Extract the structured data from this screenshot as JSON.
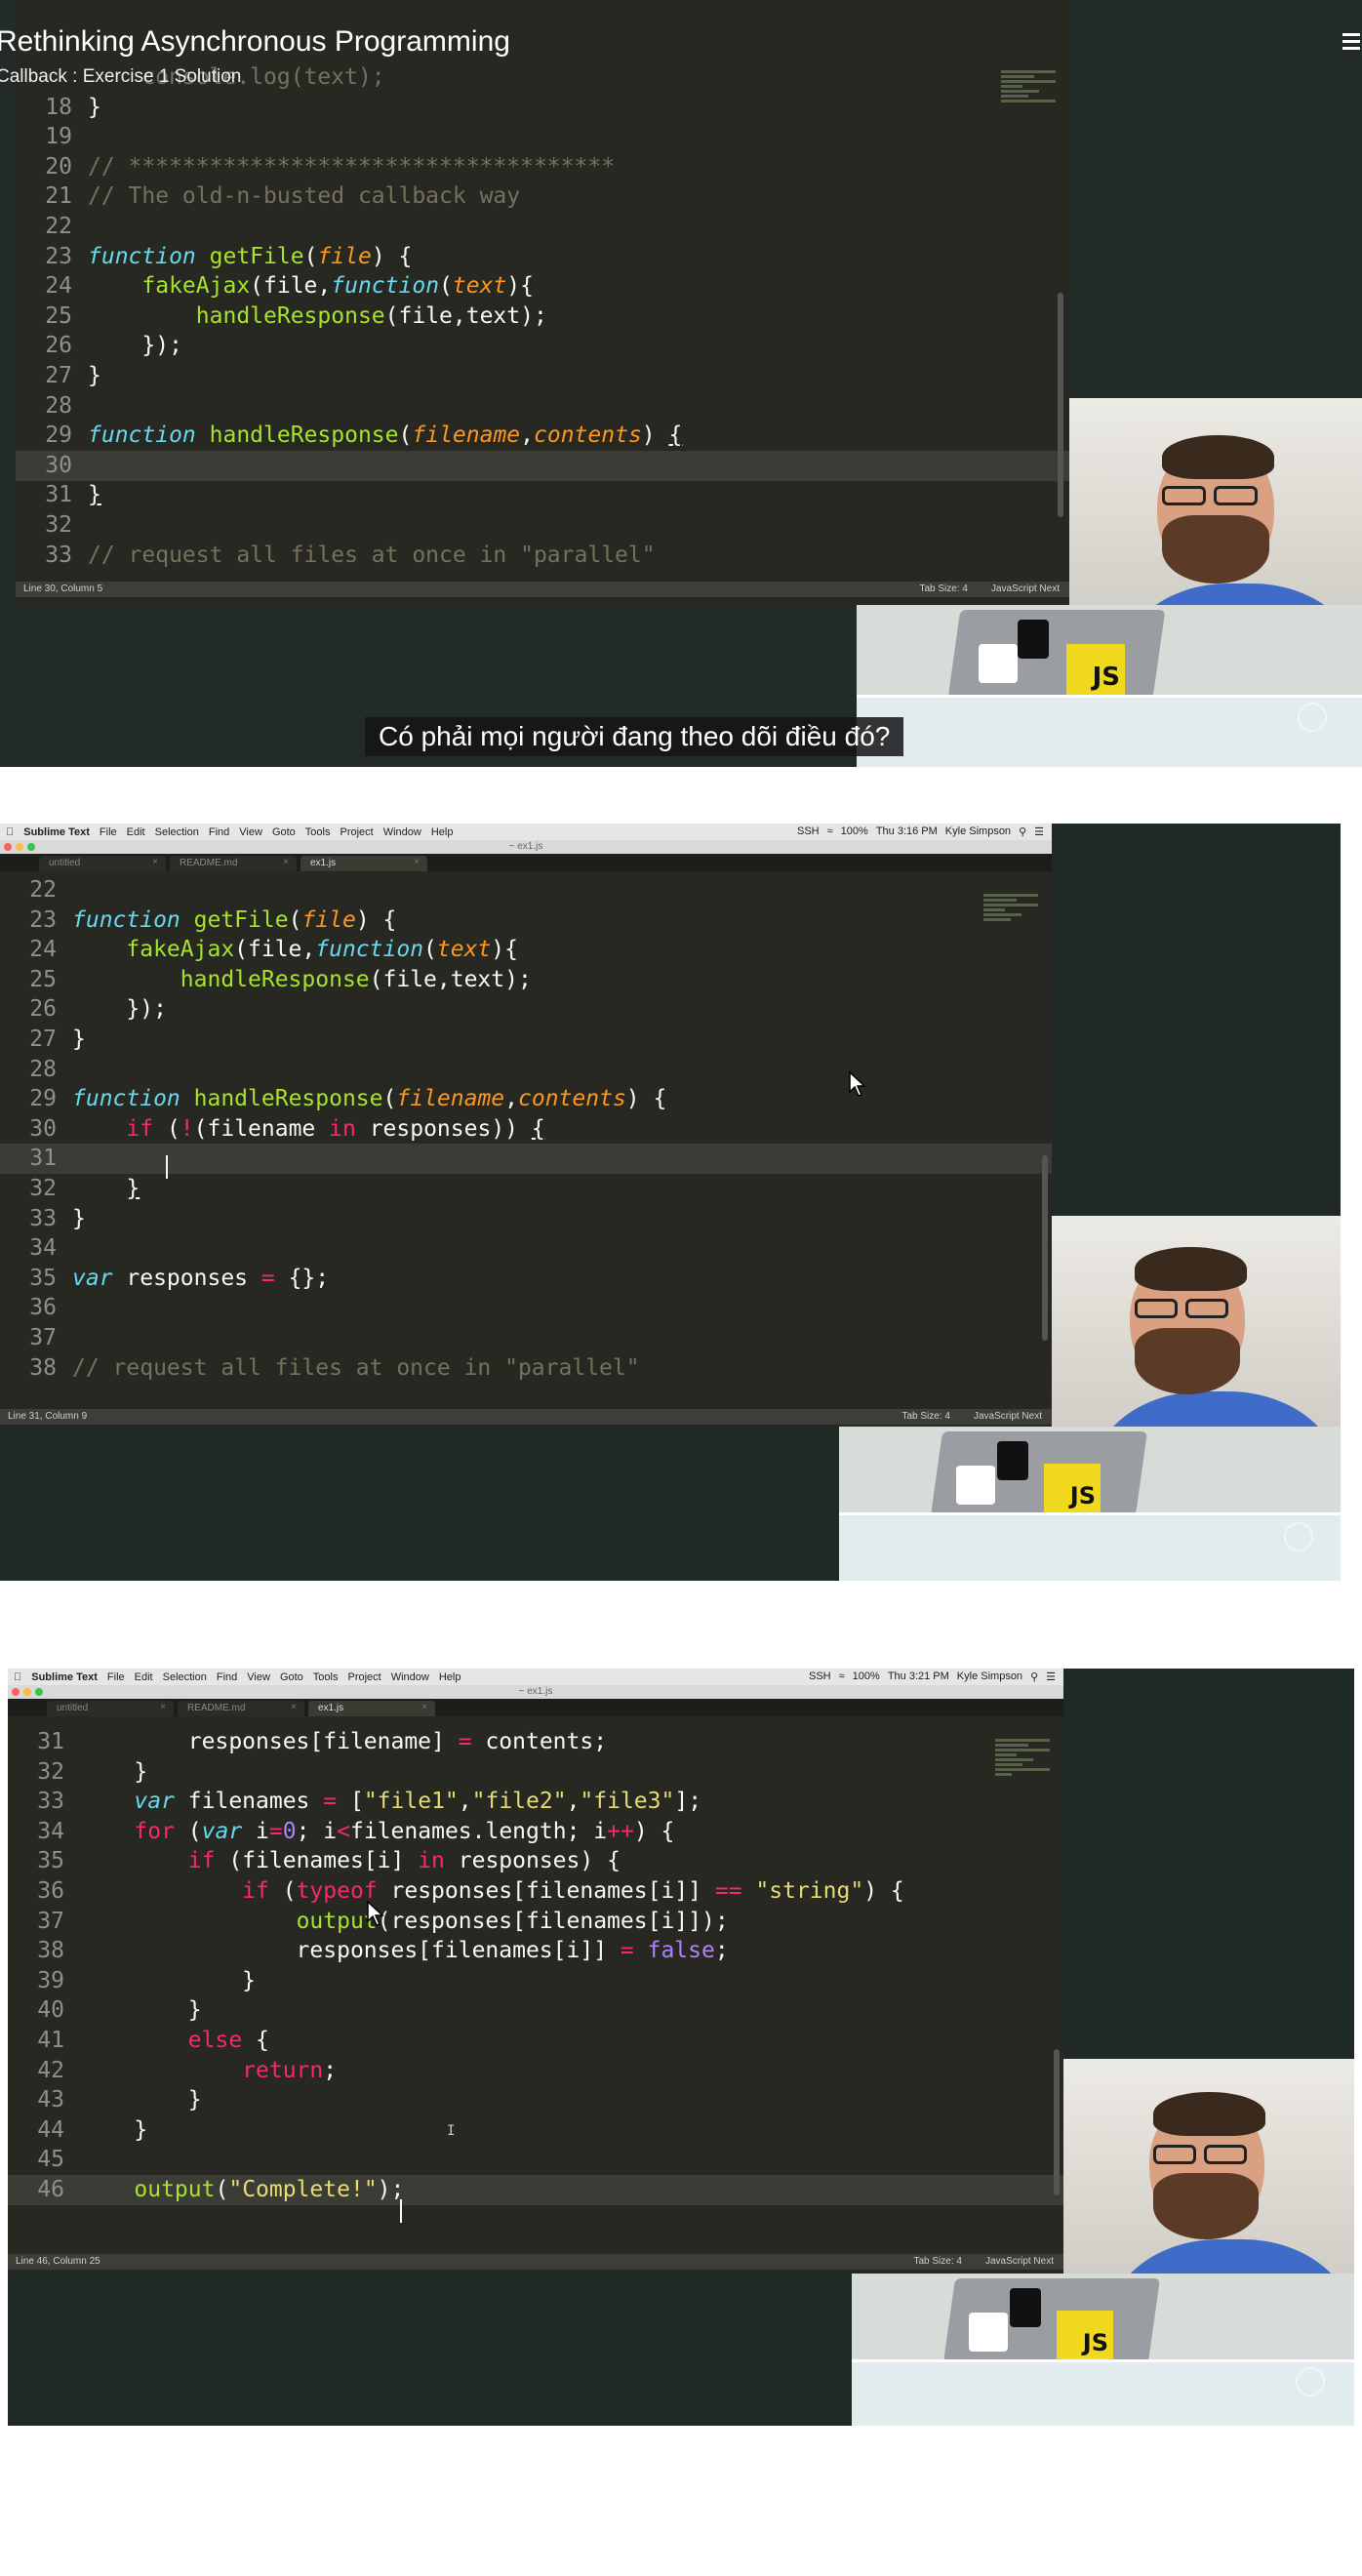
{
  "video": {
    "title": "Rethinking Asynchronous Programming",
    "subtitle": "Callback : Exercise 1 Solution",
    "caption": "Có phải mọi người đang theo dõi điều đó?"
  },
  "panel1": {
    "status": "Line 30, Column 5",
    "tab_size": "Tab Size: 4",
    "syntax": "JavaScript Next",
    "lines": [
      {
        "n": "",
        "html": "<span class='c'>    console.log(text);</span>"
      },
      {
        "n": "18",
        "html": "}"
      },
      {
        "n": "19",
        "html": ""
      },
      {
        "n": "20",
        "html": "<span class='c'>// ************************************</span>"
      },
      {
        "n": "21",
        "html": "<span class='c'>// The old-n-busted callback way</span>"
      },
      {
        "n": "22",
        "html": ""
      },
      {
        "n": "23",
        "html": "<span class='k'>function</span> <span class='fn'>getFile</span>(<span class='p'>file</span>) {"
      },
      {
        "n": "24",
        "html": "    <span class='fn'>fakeAjax</span>(file,<span class='k'>function</span>(<span class='p'>text</span>){"
      },
      {
        "n": "25",
        "html": "        <span class='fn'>handleResponse</span>(file,text);"
      },
      {
        "n": "26",
        "html": "    });"
      },
      {
        "n": "27",
        "html": "}"
      },
      {
        "n": "28",
        "html": ""
      },
      {
        "n": "29",
        "html": "<span class='k'>function</span> <span class='fn'>handleResponse</span>(<span class='p'>filename</span>,<span class='p'>contents</span>) <u>{</u>"
      },
      {
        "n": "30",
        "html": "",
        "hl": true
      },
      {
        "n": "31",
        "html": "<u>}</u>"
      },
      {
        "n": "32",
        "html": ""
      },
      {
        "n": "33",
        "html": "<span class='c'>// request all files at once in \"parallel\"</span>"
      }
    ]
  },
  "panel2": {
    "menubar": {
      "app": "Sublime Text",
      "items": [
        "File",
        "Edit",
        "Selection",
        "Find",
        "View",
        "Goto",
        "Tools",
        "Project",
        "Window",
        "Help"
      ],
      "right": [
        "SSH",
        "100%",
        "Thu 3:16 PM",
        "Kyle Simpson"
      ]
    },
    "window_title": "~ ex1.js",
    "tabs": [
      "untitled",
      "README.md",
      "ex1.js"
    ],
    "status": "Line 31, Column 9",
    "tab_size": "Tab Size: 4",
    "syntax": "JavaScript Next",
    "lines": [
      {
        "n": "22",
        "html": ""
      },
      {
        "n": "23",
        "html": "<span class='k'>function</span> <span class='fn'>getFile</span>(<span class='p'>file</span>) {"
      },
      {
        "n": "24",
        "html": "    <span class='fn'>fakeAjax</span>(file,<span class='k'>function</span>(<span class='p'>text</span>){"
      },
      {
        "n": "25",
        "html": "        <span class='fn'>handleResponse</span>(file,text);"
      },
      {
        "n": "26",
        "html": "    });"
      },
      {
        "n": "27",
        "html": "}"
      },
      {
        "n": "28",
        "html": ""
      },
      {
        "n": "29",
        "html": "<span class='k'>function</span> <span class='fn'>handleResponse</span>(<span class='p'>filename</span>,<span class='p'>contents</span>) {"
      },
      {
        "n": "30",
        "html": "    <span class='kw'>if</span> (<span class='kw'>!</span>(filename <span class='kw'>in</span> responses)) <u>{</u>"
      },
      {
        "n": "31",
        "html": "        ",
        "hl": true
      },
      {
        "n": "32",
        "html": "    <u>}</u>"
      },
      {
        "n": "33",
        "html": "}"
      },
      {
        "n": "34",
        "html": ""
      },
      {
        "n": "35",
        "html": "<span class='k'>var</span> responses <span class='kw'>=</span> {};"
      },
      {
        "n": "36",
        "html": ""
      },
      {
        "n": "37",
        "html": ""
      },
      {
        "n": "38",
        "html": "<span class='c'>// request all files at once in \"parallel\"</span>"
      }
    ]
  },
  "panel3": {
    "menubar": {
      "app": "Sublime Text",
      "items": [
        "File",
        "Edit",
        "Selection",
        "Find",
        "View",
        "Goto",
        "Tools",
        "Project",
        "Window",
        "Help"
      ],
      "right": [
        "SSH",
        "100%",
        "Thu 3:21 PM",
        "Kyle Simpson"
      ]
    },
    "window_title": "~ ex1.js",
    "tabs": [
      "untitled",
      "README.md",
      "ex1.js"
    ],
    "status": "Line 46, Column 25",
    "tab_size": "Tab Size: 4",
    "syntax": "JavaScript Next",
    "lines": [
      {
        "n": "31",
        "html": "        responses[filename] <span class='kw'>=</span> contents;"
      },
      {
        "n": "32",
        "html": "    }"
      },
      {
        "n": "33",
        "html": "    <span class='k'>var</span> filenames <span class='kw'>=</span> [<span class='s'>\"file1\"</span>,<span class='s'>\"file2\"</span>,<span class='s'>\"file3\"</span>];"
      },
      {
        "n": "34",
        "html": "    <span class='kw'>for</span> (<span class='k'>var</span> i<span class='kw'>=</span><span class='n'>0</span>; i<span class='kw'>&lt;</span>filenames.length; i<span class='kw'>++</span>) {"
      },
      {
        "n": "35",
        "html": "        <span class='kw'>if</span> (filenames[i] <span class='kw'>in</span> responses) {"
      },
      {
        "n": "36",
        "html": "            <span class='kw'>if</span> (<span class='kw'>typeof</span> responses[filenames[i]] <span class='kw'>==</span> <span class='s'>\"string\"</span>) {"
      },
      {
        "n": "37",
        "html": "                <span class='fn'>output</span>(responses[filenames[i]]);"
      },
      {
        "n": "38",
        "html": "                responses[filenames[i]] <span class='kw'>=</span> <span class='n'>false</span>;"
      },
      {
        "n": "39",
        "html": "            }"
      },
      {
        "n": "40",
        "html": "        }"
      },
      {
        "n": "41",
        "html": "        <span class='kw'>else</span> {"
      },
      {
        "n": "42",
        "html": "            <span class='kw'>return</span>;"
      },
      {
        "n": "43",
        "html": "        }"
      },
      {
        "n": "44",
        "html": "    }"
      },
      {
        "n": "45",
        "html": ""
      },
      {
        "n": "46",
        "html": "    <span class='fn'>output</span>(<span class='s'>\"Complete!\"</span>);",
        "hl": true
      }
    ]
  },
  "stickers": {
    "js": "JS"
  },
  "colors": {
    "editor_bg": "#272822",
    "keyword": "#f92672",
    "function": "#a6e22e",
    "param": "#fd971f",
    "comment": "#75715e",
    "string": "#e6db74",
    "storage": "#66d9ef"
  }
}
